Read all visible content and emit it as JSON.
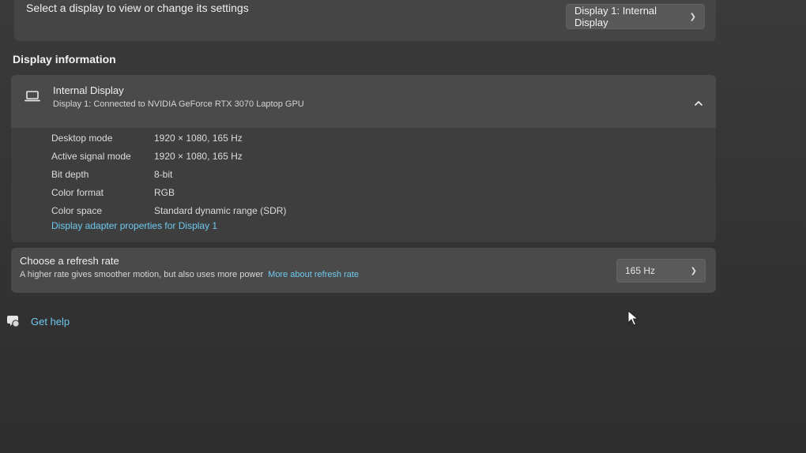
{
  "display_selector": {
    "label": "Select a display to view or change its settings",
    "selected": "Display 1: Internal Display"
  },
  "display_information": {
    "section_title": "Display information",
    "display_name": "Internal Display",
    "display_subtitle": "Display 1: Connected to NVIDIA GeForce RTX 3070 Laptop GPU",
    "rows": [
      {
        "key": "Desktop mode",
        "value": "1920 × 1080, 165 Hz"
      },
      {
        "key": "Active signal mode",
        "value": "1920 × 1080, 165 Hz"
      },
      {
        "key": "Bit depth",
        "value": "8-bit"
      },
      {
        "key": "Color format",
        "value": "RGB"
      },
      {
        "key": "Color space",
        "value": "Standard dynamic range (SDR)"
      }
    ],
    "adapter_link": "Display adapter properties for Display 1"
  },
  "refresh_rate": {
    "title": "Choose a refresh rate",
    "description": "A higher rate gives smoother motion, but also uses more power",
    "link": "More about refresh rate",
    "selected": "165 Hz"
  },
  "help": {
    "label": "Get help"
  },
  "icons": {
    "display": "laptop-icon",
    "collapse": "chevron-up-icon",
    "dropdown": "chevron-down-icon",
    "help": "help-chat-icon",
    "cursor": "mouse-pointer-icon"
  },
  "colors": {
    "link": "#6fc9ee"
  }
}
